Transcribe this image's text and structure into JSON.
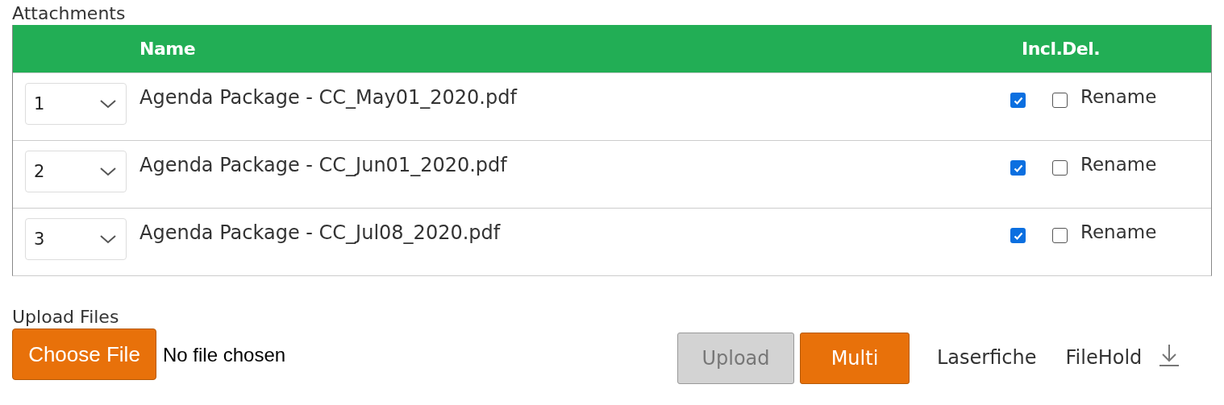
{
  "attachments": {
    "title": "Attachments",
    "columns": [
      {
        "label": "Name"
      },
      {
        "label": "Incl."
      },
      {
        "label": "Del."
      }
    ],
    "rows": [
      {
        "order": "1",
        "name": "Agenda Package - CC_May01_2020.pdf",
        "included": true,
        "deleted": false,
        "action": "Rename"
      },
      {
        "order": "2",
        "name": "Agenda Package - CC_Jun01_2020.pdf",
        "included": true,
        "deleted": false,
        "action": "Rename"
      },
      {
        "order": "3",
        "name": "Agenda Package - CC_Jul08_2020.pdf",
        "included": true,
        "deleted": false,
        "action": "Rename"
      }
    ]
  },
  "upload": {
    "title": "Upload Files",
    "choose_button": "Choose File",
    "file_status": "No file chosen",
    "buttons": [
      {
        "label": "Upload",
        "disabled": true
      },
      {
        "label": "Multi",
        "disabled": false
      }
    ],
    "links": [
      "Laserfiche",
      "FileHold"
    ]
  }
}
